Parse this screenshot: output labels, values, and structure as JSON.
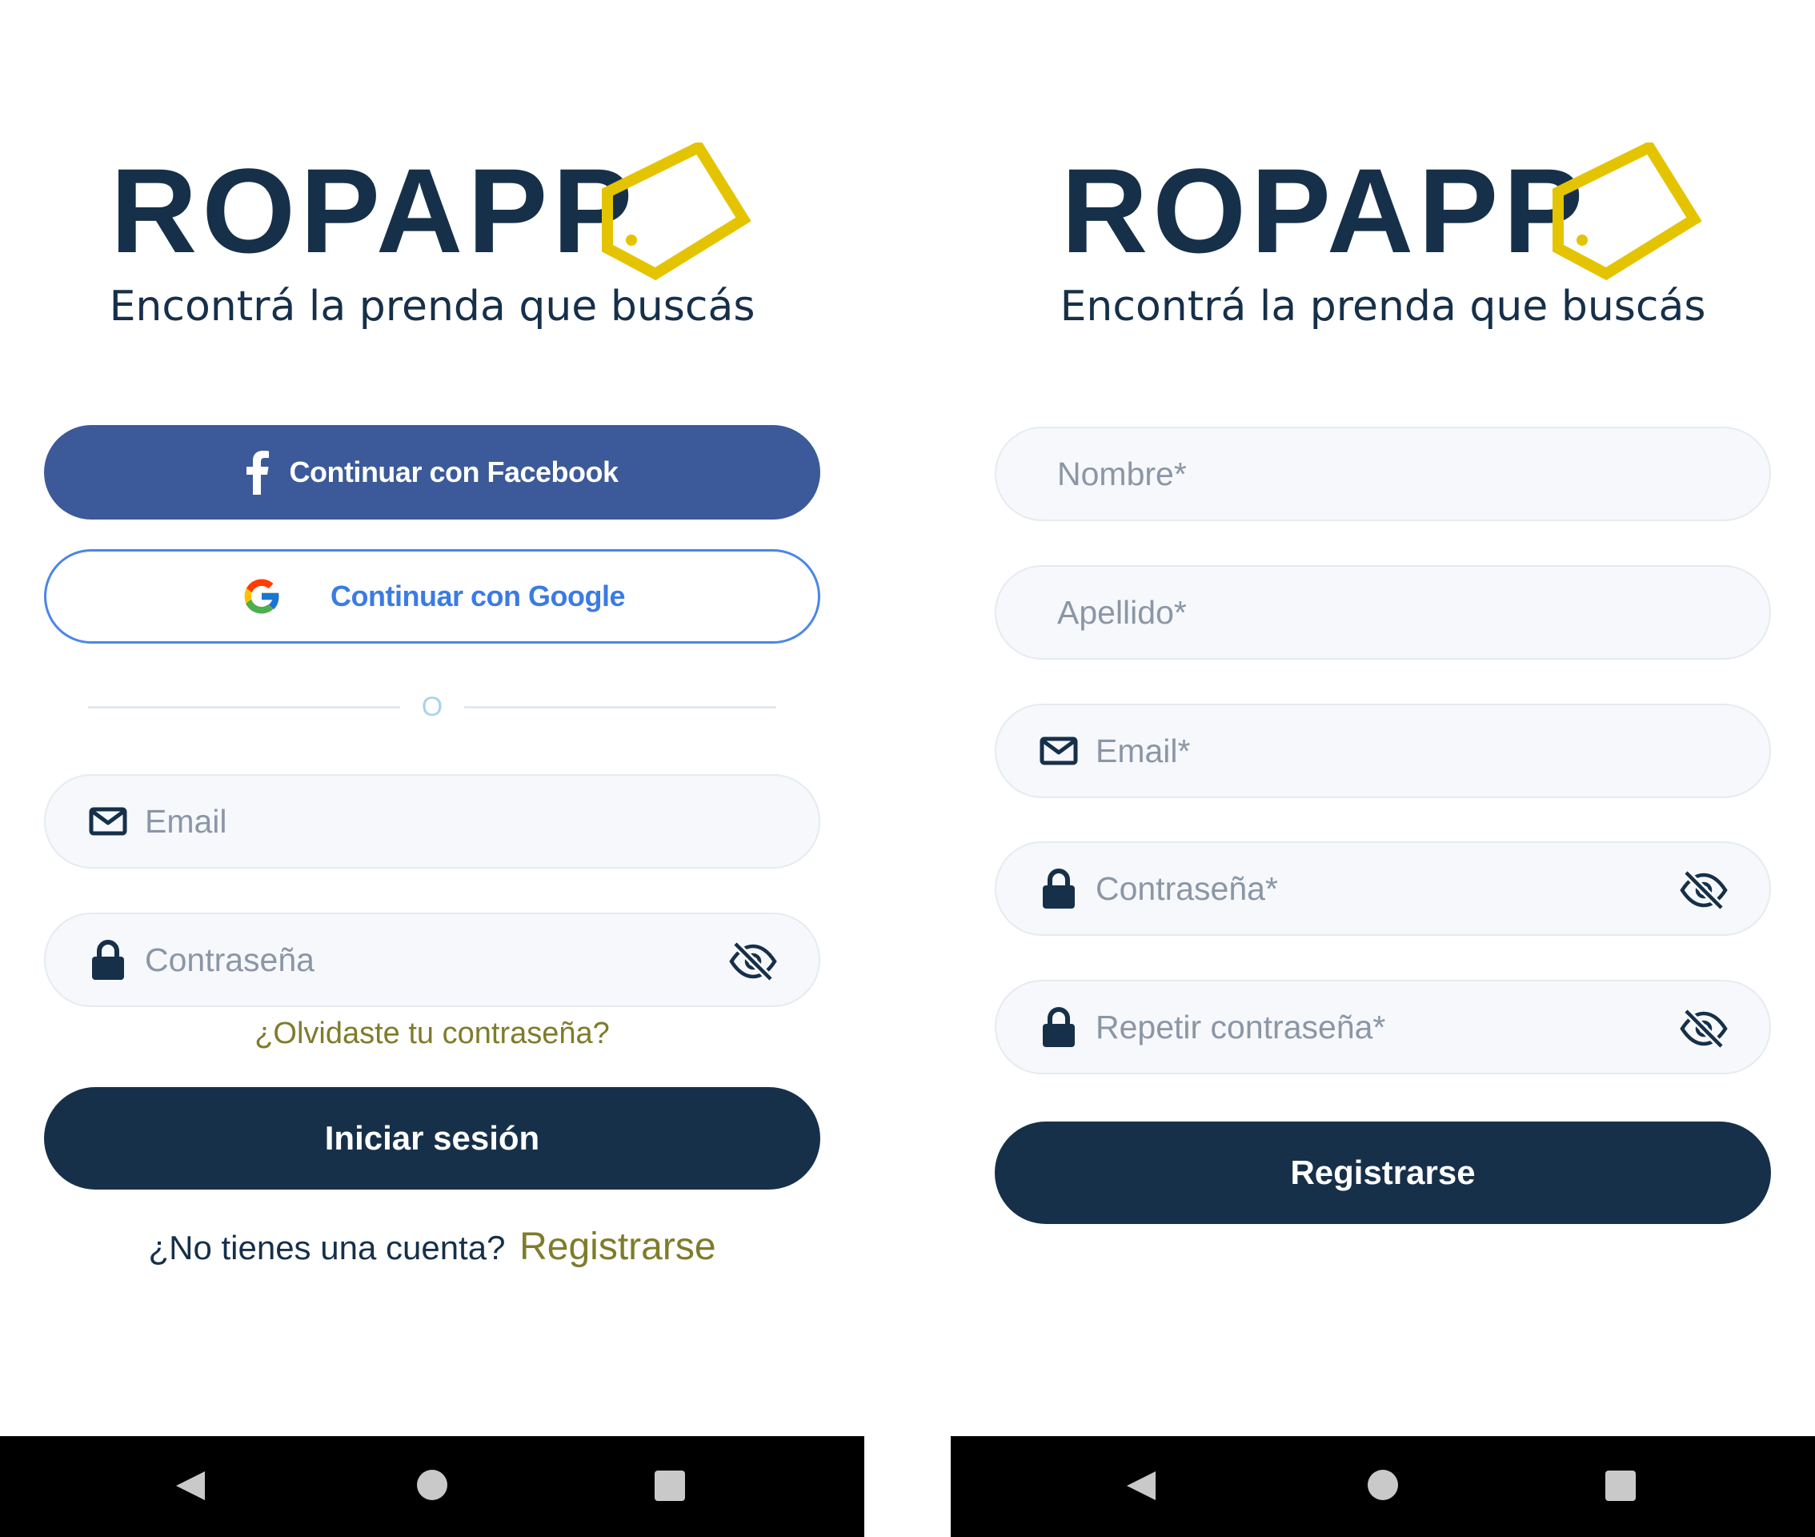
{
  "login": {
    "logo_text": "ROPAPP",
    "tagline": "Encontrá la prenda que buscás",
    "facebook_button": "Continuar con Facebook",
    "google_button": "Continuar con Google",
    "divider_text": "O",
    "email_placeholder": "Email",
    "password_placeholder": "Contraseña",
    "forgot_password": "¿Olvidaste tu contraseña?",
    "login_button": "Iniciar sesión",
    "no_account_text": "¿No tienes una cuenta?",
    "register_link": "Registrarse"
  },
  "register": {
    "logo_text": "ROPAPP",
    "tagline": "Encontrá la prenda que buscás",
    "first_name_placeholder": "Nombre*",
    "last_name_placeholder": "Apellido*",
    "email_placeholder": "Email*",
    "password_placeholder": "Contraseña*",
    "repeat_password_placeholder": "Repetir contraseña*",
    "register_button": "Registrarse"
  },
  "colors": {
    "navy": "#16304a",
    "facebook_blue": "#3c5a99",
    "google_blue": "#4a86e8",
    "link_olive": "#7e7c2a",
    "tag_yellow": "#e4c400",
    "field_bg": "#f6f8fb"
  },
  "icons": {
    "facebook": "facebook-f-icon",
    "google": "google-g-icon",
    "email": "envelope-icon",
    "password": "lock-icon",
    "visibility": "eye-off-icon",
    "nav_back": "triangle-back-icon",
    "nav_home": "circle-home-icon",
    "nav_recent": "square-recent-icon"
  }
}
